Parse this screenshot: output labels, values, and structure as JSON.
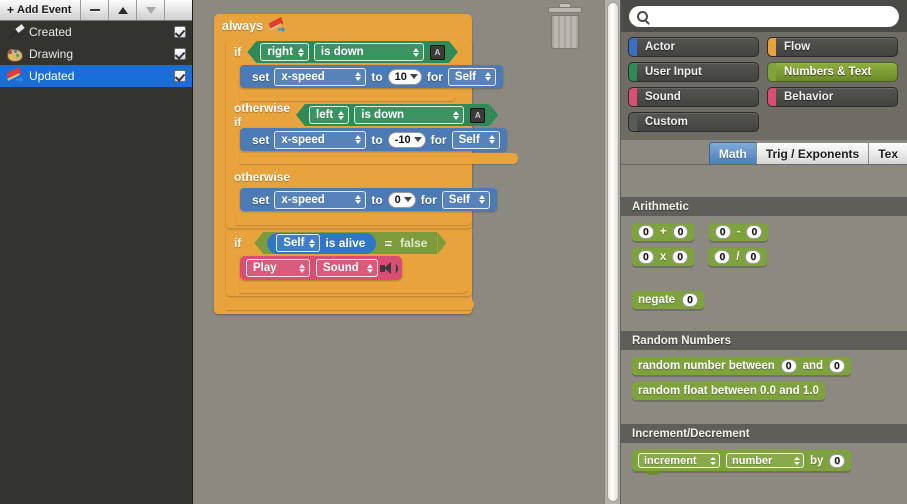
{
  "left_panel": {
    "toolbar": {
      "add_event_label": "Add Event",
      "add_event_plus": "+",
      "remove_icon": "minus-icon",
      "move_up_icon": "triangle-up-icon",
      "move_down_icon": "triangle-down-icon"
    },
    "events": [
      {
        "label": "Created",
        "icon": "hammer-icon",
        "checked": true,
        "selected": false
      },
      {
        "label": "Drawing",
        "icon": "palette-icon",
        "checked": true,
        "selected": false
      },
      {
        "label": "Updated",
        "icon": "flag-icon",
        "checked": true,
        "selected": true
      }
    ]
  },
  "canvas": {
    "trash_icon": "trash-can-icon",
    "script": {
      "always_label": "always",
      "always_icon": "flag-icon",
      "if_label": "if",
      "otherwise_if_label": "otherwise if",
      "otherwise_label": "otherwise",
      "branch1": {
        "key": "right",
        "state": "is down",
        "key_badge": "A",
        "set_label": "set",
        "attribute": "x-speed",
        "to_label": "to",
        "value": "10",
        "for_label": "for",
        "target": "Self"
      },
      "branch2": {
        "key": "left",
        "state": "is down",
        "key_badge": "A",
        "set_label": "set",
        "attribute": "x-speed",
        "to_label": "to",
        "value": "-10",
        "for_label": "for",
        "target": "Self"
      },
      "branch3": {
        "set_label": "set",
        "attribute": "x-speed",
        "to_label": "to",
        "value": "0",
        "for_label": "for",
        "target": "Self"
      },
      "alive_check": {
        "if_label": "if",
        "actor": "Self",
        "predicate": "is alive",
        "equals": "=",
        "compare_value": "false"
      },
      "sound_block": {
        "action": "Play",
        "sound": "Sound",
        "speaker_icon": "speaker-icon"
      }
    }
  },
  "right_panel": {
    "search": {
      "value": "",
      "placeholder": "",
      "icon": "search-icon"
    },
    "categories": [
      {
        "label": "Actor",
        "color": "#3b6fc4",
        "active": false
      },
      {
        "label": "Flow",
        "color": "#e8a33d",
        "active": false
      },
      {
        "label": "User Input",
        "color": "#2e8b57",
        "active": false
      },
      {
        "label": "Numbers & Text",
        "color": "#7fa33c",
        "active": true
      },
      {
        "label": "Sound",
        "color": "#d94e72",
        "active": false
      },
      {
        "label": "Behavior",
        "color": "#d94e72",
        "active": false
      },
      {
        "label": "Custom",
        "color": "#5a5a56",
        "active": false
      }
    ],
    "tabs": [
      {
        "label": "Math",
        "active": true
      },
      {
        "label": "Trig / Exponents",
        "active": false
      },
      {
        "label": "Tex",
        "active": false
      }
    ],
    "sections": [
      {
        "title": "Arithmetic",
        "rows": [
          [
            {
              "type": "binary",
              "left": "0",
              "op": "+",
              "right": "0"
            },
            {
              "type": "binary",
              "left": "0",
              "op": "-",
              "right": "0"
            }
          ],
          [
            {
              "type": "binary",
              "left": "0",
              "op": "x",
              "right": "0"
            },
            {
              "type": "binary",
              "left": "0",
              "op": "/",
              "right": "0"
            }
          ],
          [
            {
              "type": "prefix",
              "label": "negate",
              "value": "0"
            }
          ]
        ]
      },
      {
        "title": "Random Numbers",
        "rows": [
          [
            {
              "type": "random_between",
              "prefix": "random number between",
              "v1": "0",
              "mid": "and",
              "v2": "0"
            }
          ],
          [
            {
              "type": "text_only",
              "label": "random float between 0.0 and 1.0"
            }
          ]
        ]
      },
      {
        "title": "Increment/Decrement",
        "rows": [
          [
            {
              "type": "increment",
              "action": "increment",
              "attribute": "number",
              "by_label": "by",
              "value": "0"
            }
          ]
        ]
      }
    ]
  }
}
